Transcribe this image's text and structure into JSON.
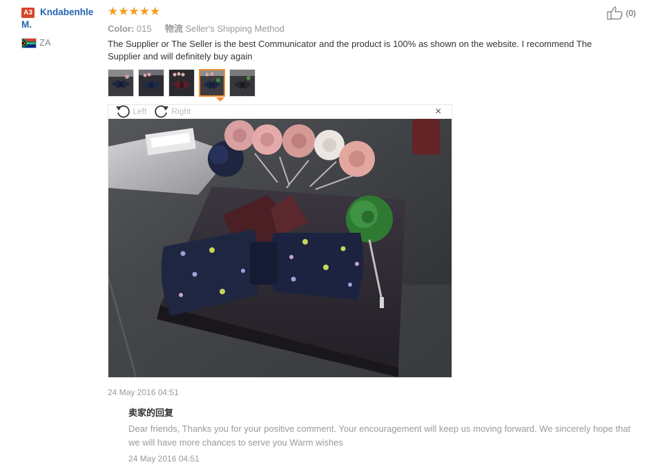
{
  "user": {
    "level_badge": "A3",
    "name_first": "Kndabenhle",
    "name_second": "M.",
    "country": "ZA"
  },
  "review": {
    "stars": [
      "★",
      "★",
      "★",
      "★",
      "★"
    ],
    "color_label": "Color:",
    "color_value": "015",
    "logistics_label": "物流",
    "logistics_value": "Seller's Shipping Method",
    "text": "The Supplier or The Seller is the best Communicator and the product is 100% as shown on the website. I recommend The Supplier and will definitely buy again",
    "date": "24 May 2016 04:51"
  },
  "helpful": {
    "count": "(0)"
  },
  "viewer": {
    "rotate_left": "Left",
    "rotate_right": "Right",
    "close": "×",
    "active_thumbnail_index": 3
  },
  "reply": {
    "title": "卖家的回复",
    "text": "Dear friends, Thanks you for your positive comment. Your encouragement will keep us moving forward. We sincerely hope that we will have more chances to serve you Warm wishes",
    "date": "24 May 2016 04:51"
  },
  "colors": {
    "name_link": "#2263b0",
    "star": "#f59c1a",
    "badge": "#d9442c",
    "active_thumb": "#f08a2a"
  }
}
